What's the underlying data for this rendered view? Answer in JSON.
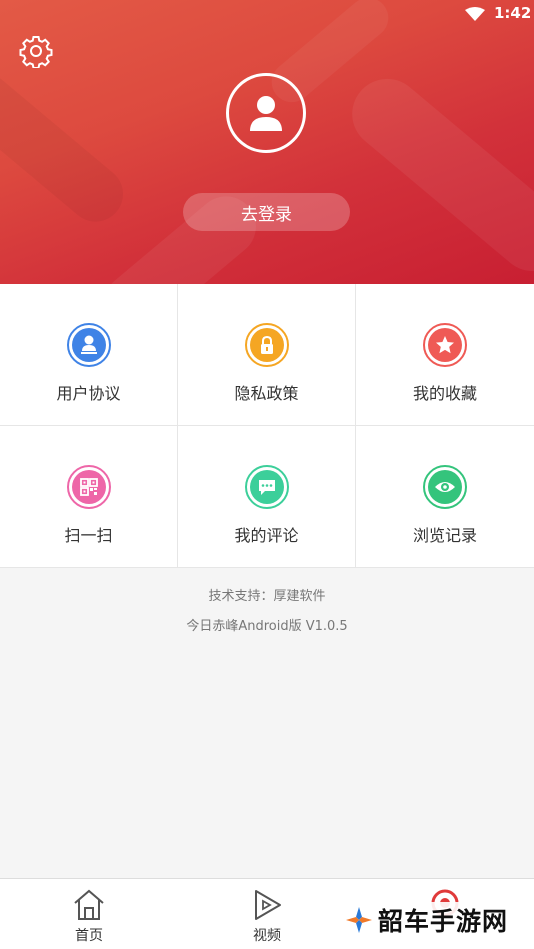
{
  "status_bar": {
    "time": "1:42"
  },
  "header": {
    "login_label": "去登录"
  },
  "grid": {
    "items": [
      {
        "label": "用户协议",
        "icon": "user-agreement-icon",
        "color": "#3f83e6"
      },
      {
        "label": "隐私政策",
        "icon": "lock-icon",
        "color": "#f5a623"
      },
      {
        "label": "我的收藏",
        "icon": "star-icon",
        "color": "#ef5a55"
      },
      {
        "label": "扫一扫",
        "icon": "qr-code-icon",
        "color": "#ee66a8"
      },
      {
        "label": "我的评论",
        "icon": "comment-icon",
        "color": "#3ccf9a"
      },
      {
        "label": "浏览记录",
        "icon": "eye-icon",
        "color": "#34c47c"
      }
    ]
  },
  "footer": {
    "support": "技术支持：厚建软件",
    "version": "今日赤峰Android版 V1.0.5"
  },
  "bottom_nav": {
    "items": [
      {
        "label": "首页",
        "icon": "home-icon"
      },
      {
        "label": "视频",
        "icon": "play-icon"
      },
      {
        "label": "",
        "icon": "location-pin-icon"
      }
    ]
  },
  "watermark": {
    "text": "韶车手游网"
  },
  "colors": {
    "header_red": "#d2313a",
    "accent": "#e03a3a"
  }
}
